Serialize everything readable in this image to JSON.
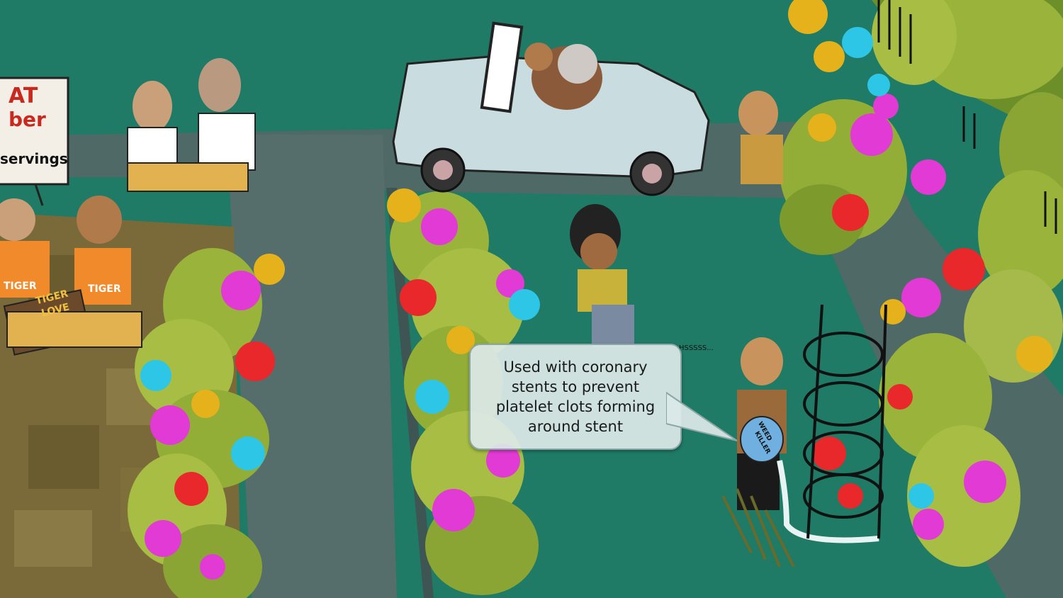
{
  "callout": {
    "text": "Used with coronary stents to prevent platelet clots forming around stent"
  },
  "sign": {
    "line1": "AT",
    "line2": "ber",
    "line3": "servings"
  },
  "shirts": {
    "left": "TIGER",
    "right": "TIGER"
  },
  "book": {
    "title_line1": "TIGER",
    "title_line2": "LOVE"
  },
  "jug": {
    "label_line1": "WEED",
    "label_line2": "KILLER"
  },
  "sound": {
    "text": "HSSSSS..."
  },
  "colors": {
    "grass": "#1f7a66",
    "path": "#4f6a66",
    "flower_magenta": "#e23ad4",
    "flower_red": "#e8282a",
    "flower_cyan": "#2ec6e6",
    "flower_yellow": "#e6b21c"
  }
}
